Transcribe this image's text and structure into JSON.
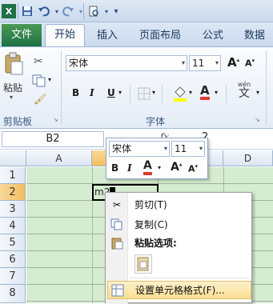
{
  "qat": {
    "excel_icon": "excel-logo",
    "save_icon": "save-icon",
    "undo_icon": "undo-icon",
    "redo_icon": "redo-icon",
    "print_icon": "print-preview-icon",
    "custom_icon": "dropdown-icon"
  },
  "tabs": {
    "file": "文件",
    "home": "开始",
    "insert": "插入",
    "page_layout": "页面布局",
    "formulas": "公式",
    "data": "数据"
  },
  "ribbon": {
    "paste_label": "粘贴",
    "clipboard_group": "剪贴板",
    "font_name": "宋体",
    "font_size": "11",
    "bold": "B",
    "italic": "I",
    "underline": "U",
    "font_color": "A",
    "grow": "A",
    "shrink": "A",
    "font_group": "字体",
    "wen": "wén",
    "wen_char": "文"
  },
  "formula_bar": {
    "name_box": "B2",
    "fx": "fx",
    "partial_value": "2"
  },
  "grid": {
    "columns": [
      "A",
      "B",
      "C",
      "D"
    ],
    "rows": [
      "1",
      "2",
      "3",
      "4",
      "5",
      "6",
      "7",
      "8"
    ],
    "b2_value": "m2"
  },
  "mini_toolbar": {
    "font_name": "宋体",
    "font_size": "11",
    "bold": "B",
    "italic": "I",
    "font_color": "A",
    "grow": "A",
    "shrink": "A"
  },
  "context_menu": {
    "cut": "剪切(T)",
    "copy": "复制(C)",
    "paste_options": "粘贴选项:",
    "format_cells": "设置单元格格式(F)..."
  },
  "colors": {
    "file_tab": "#1e7145",
    "cell_fill": "#d6ecd1",
    "selection": "#000000"
  }
}
